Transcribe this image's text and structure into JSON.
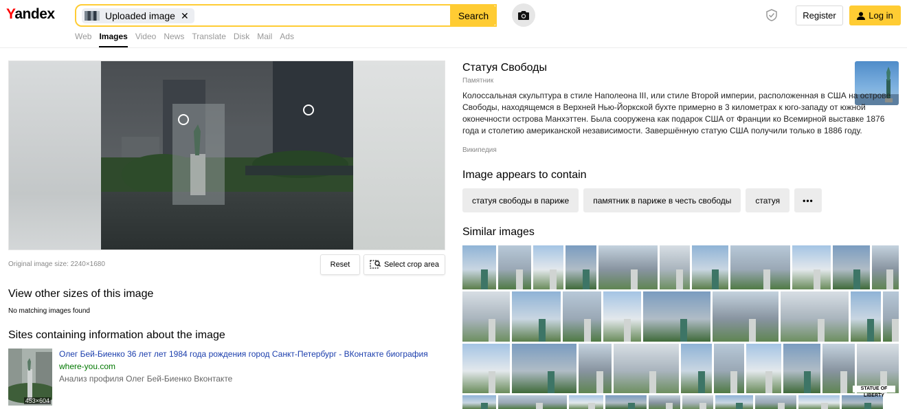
{
  "header": {
    "logo": "Yandex",
    "logo_first": "Y",
    "logo_rest": "andex",
    "search_chip": "Uploaded image",
    "search_chip_close": "✕",
    "search_button": "Search",
    "nav": [
      {
        "label": "Web",
        "active": false
      },
      {
        "label": "Images",
        "active": true
      },
      {
        "label": "Video",
        "active": false
      },
      {
        "label": "News",
        "active": false
      },
      {
        "label": "Translate",
        "active": false
      },
      {
        "label": "Disk",
        "active": false
      },
      {
        "label": "Mail",
        "active": false
      },
      {
        "label": "Ads",
        "active": false
      }
    ],
    "register": "Register",
    "login": "Log in"
  },
  "left": {
    "image_size": "Original image size: 2240×1680",
    "reset": "Reset",
    "select_crop": "Select crop area",
    "other_sizes_title": "View other sizes of this image",
    "no_matching": "No matching images found",
    "sites_title": "Sites containing information about the image",
    "site": {
      "title": "Олег Бей-Биенко 36 лет лет 1984 года рождения город Санкт-Петербург - ВКонтакте биография",
      "domain": "where-you.com",
      "description": "Анализ профиля Олег Бей-Биенко Вконтакте",
      "thumb_size": "453×604"
    }
  },
  "right": {
    "entity_title": "Статуя Свободы",
    "entity_type": "Памятник",
    "entity_description": "Колоссальная скульптура в стиле Наполеона III, или стиле Второй империи, расположенная в США на острове Свободы, находящемся в Верхней Нью-Йоркской бухте примерно в 3 километрах к юго-западу от южной оконечности острова Манхэттен. Была сооружена как подарок США от Франции ко Всемирной выставке 1876 года и столетию американской независимости. Завершённую статую США получили только в 1886 году.",
    "entity_source": "Википедия",
    "tags_title": "Image appears to contain",
    "tags": [
      "статуя свободы в париже",
      "памятник в париже в честь свободы",
      "статуя"
    ],
    "tags_more": "•••",
    "similar_title": "Similar images",
    "statue_of_liberty_label": "STATUE OF LIBERTY"
  },
  "colors": {
    "accent_yellow": "#ffcc33",
    "logo_red": "#ff0000",
    "link_blue": "#1a3dac",
    "domain_green": "#007700"
  }
}
